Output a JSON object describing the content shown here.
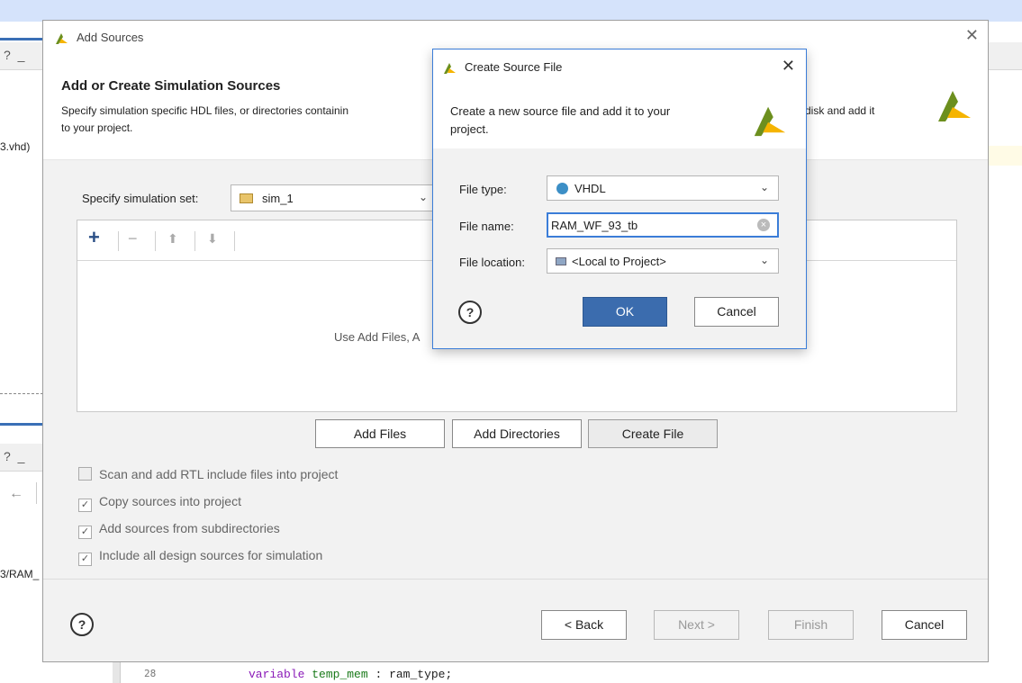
{
  "background": {
    "file_label_1": "3.vhd)",
    "file_label_2": "3/RAM_",
    "panel_icons_1": "? _",
    "panel_icons_2": "? _",
    "back_arrow": "←",
    "code_line_number": "28",
    "code_keyword": "variable",
    "code_identifier": "temp_mem",
    "code_rest": ": ram_type;"
  },
  "add_sources": {
    "window_title": "Add Sources",
    "close_glyph": "✕",
    "heading": "Add or Create Simulation Sources",
    "desc_line1_left": "Specify simulation specific HDL files, or directories containin",
    "desc_line1_right": "n disk and add it",
    "desc_line2": "to your project.",
    "simset_label": "Specify simulation set:",
    "simset_value": "sim_1",
    "toolbar": {
      "add": "+",
      "remove": "−",
      "up": "⬆",
      "down": "⬇"
    },
    "list_hint": "Use Add Files, A",
    "buttons": {
      "add_files": "Add Files",
      "add_directories": "Add Directories",
      "create_file": "Create File"
    },
    "options": [
      {
        "label": "Scan and add RTL include files into project",
        "checked": false,
        "enabled": false
      },
      {
        "label": "Copy sources into project",
        "checked": true,
        "enabled": true
      },
      {
        "label": "Add sources from subdirectories",
        "checked": true,
        "enabled": true
      },
      {
        "label": "Include all design sources for simulation",
        "checked": true,
        "enabled": true
      }
    ],
    "footer": {
      "help": "?",
      "back": "< Back",
      "next": "Next >",
      "finish": "Finish",
      "cancel": "Cancel"
    }
  },
  "create_source_file": {
    "window_title": "Create Source File",
    "close_glyph": "✕",
    "desc_line1": "Create a new source file and add it to your",
    "desc_line2": "project.",
    "file_type_label": "File type:",
    "file_type_value": "VHDL",
    "file_name_label": "File name:",
    "file_name_value": "RAM_WF_93_tb",
    "file_location_label": "File location:",
    "file_location_value": "<Local to Project>",
    "help": "?",
    "ok": "OK",
    "cancel": "Cancel"
  },
  "colors": {
    "accent": "#3b7dd8",
    "ok_button": "#3b6cae",
    "vhdl_dot": "#3c8fc6",
    "logo_green": "#6c8f1e",
    "logo_yellow": "#f5b400"
  }
}
